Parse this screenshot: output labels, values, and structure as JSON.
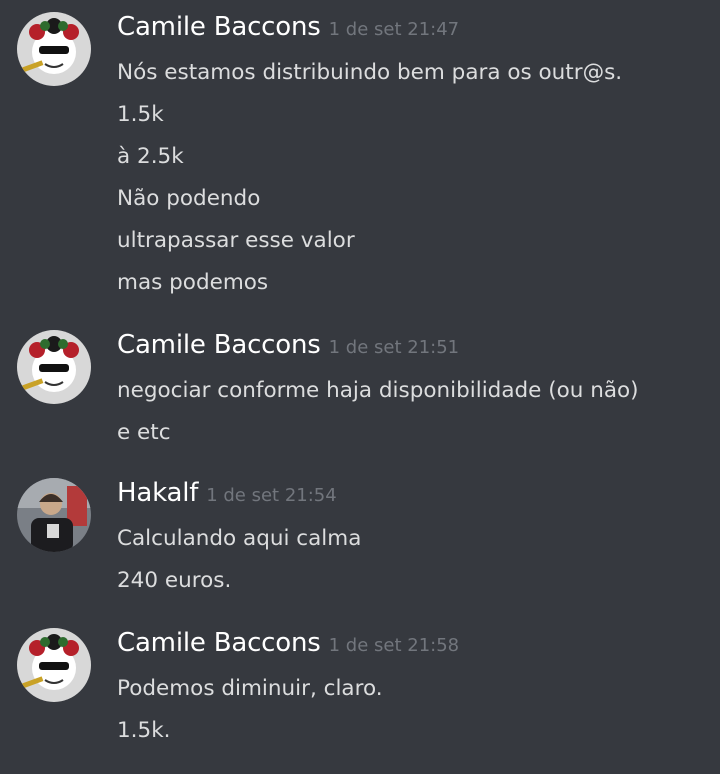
{
  "messages": [
    {
      "author": "Camile Baccons",
      "avatar": "camile-avatar",
      "timestamp": "1 de set 21:47",
      "lines": [
        "Nós estamos distribuindo bem para os outr@s.",
        "1.5k",
        "à 2.5k",
        "Não podendo",
        "ultrapassar esse valor",
        "mas podemos"
      ]
    },
    {
      "author": "Camile Baccons",
      "avatar": "camile-avatar",
      "timestamp": "1 de set 21:51",
      "lines": [
        "negociar conforme haja disponibilidade (ou não)",
        "e etc"
      ]
    },
    {
      "author": "Hakalf",
      "avatar": "hakalf-avatar",
      "timestamp": "1 de set 21:54",
      "lines": [
        "Calculando aqui calma",
        "240 euros."
      ]
    },
    {
      "author": "Camile Baccons",
      "avatar": "camile-avatar",
      "timestamp": "1 de set 21:58",
      "lines": [
        "Podemos diminuir, claro.",
        "1.5k."
      ]
    }
  ],
  "colors": {
    "background": "#36393f",
    "author": "#ffffff",
    "timestamp": "#72767d",
    "text": "#dcddde"
  }
}
